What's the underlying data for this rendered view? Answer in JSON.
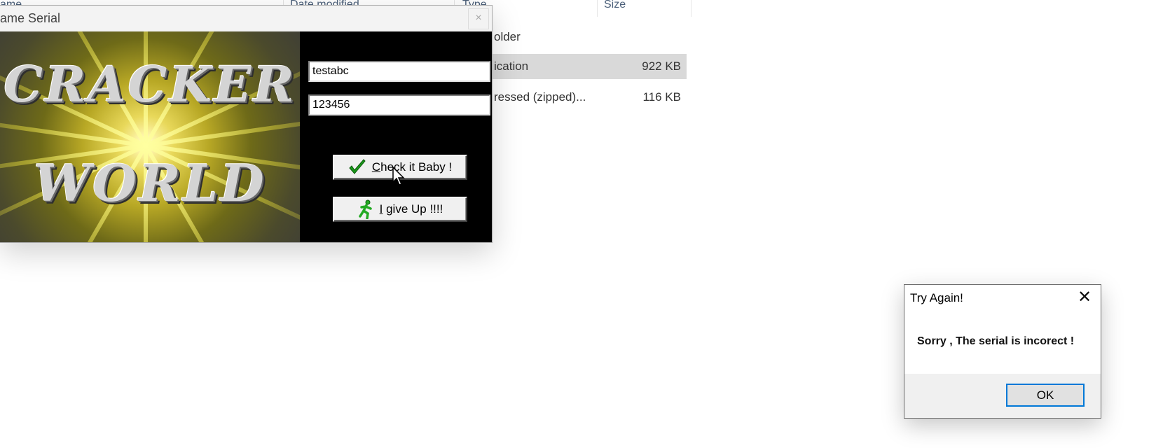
{
  "explorer": {
    "columns": {
      "name": "ame",
      "date_modified": "Date modified",
      "type": "Type",
      "size": "Size"
    },
    "rows": [
      {
        "type": "older",
        "size": ""
      },
      {
        "type": "ication",
        "size": "922 KB"
      },
      {
        "type": "ressed (zipped)...",
        "size": "116 KB"
      }
    ]
  },
  "crackme": {
    "title": "ame Serial",
    "close_label": "×",
    "banner": {
      "line1": "CRACKER",
      "line2": "WORLD"
    },
    "name_value": "testabc",
    "serial_value": "123456",
    "check_button": {
      "underlined": "C",
      "rest": "heck it Baby !"
    },
    "giveup_button": {
      "underlined": "I",
      "rest": " give Up !!!!"
    },
    "icons": {
      "check": "checkmark-icon",
      "giveup": "running-man-icon"
    }
  },
  "message_box": {
    "title": "Try Again!",
    "close_label": "✕",
    "message": "Sorry , The serial is incorect !",
    "ok_label": "OK"
  },
  "colors": {
    "focus_border": "#0078d7",
    "check_green": "#1a9a1a",
    "runner_green": "#22aa22"
  }
}
